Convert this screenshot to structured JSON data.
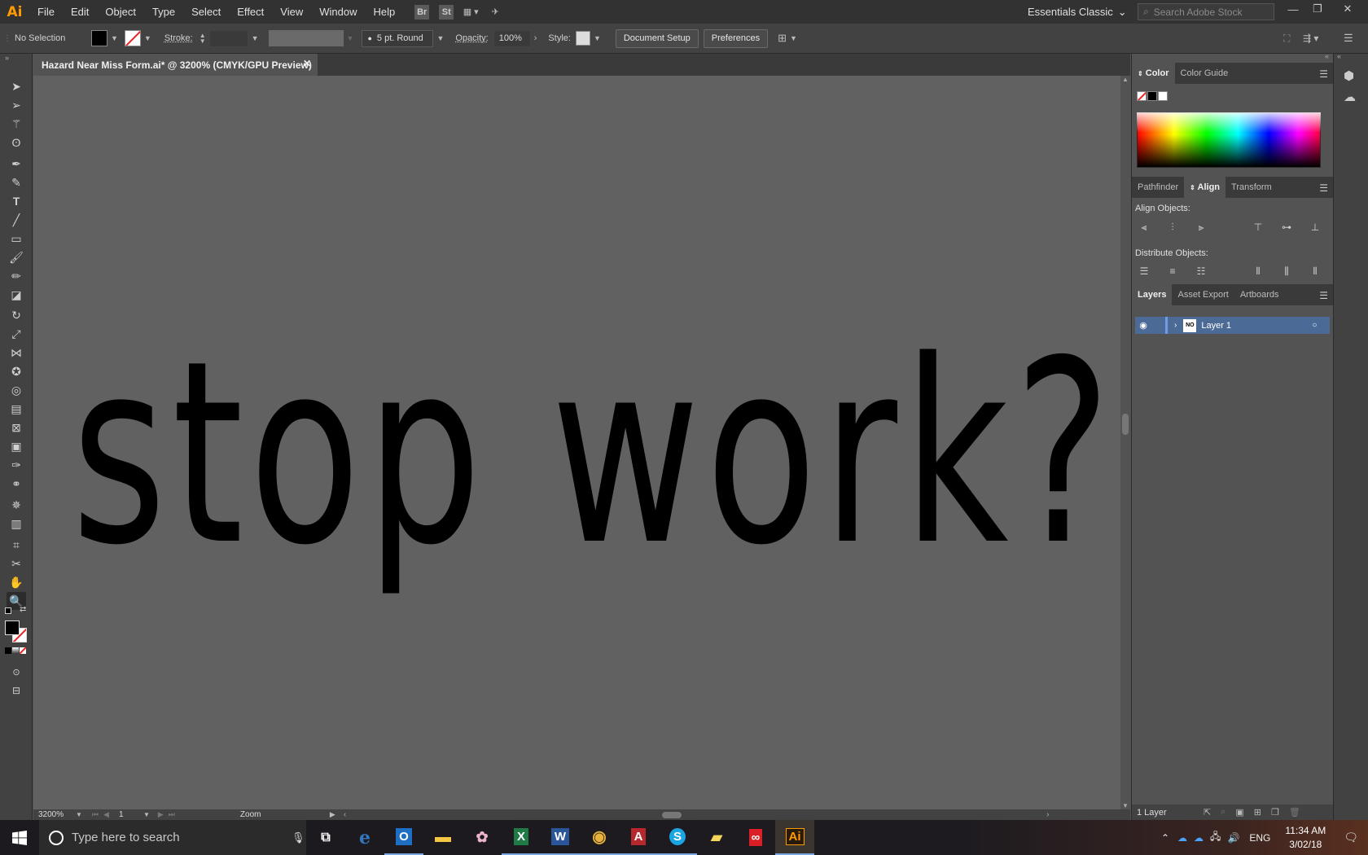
{
  "app": {
    "logo": "Ai",
    "workspace": "Essentials Classic"
  },
  "menu": [
    "File",
    "Edit",
    "Object",
    "Type",
    "Select",
    "Effect",
    "View",
    "Window",
    "Help"
  ],
  "menubar_icons": {
    "bridge": "Br",
    "stock": "St"
  },
  "stock_search": {
    "placeholder": "Search Adobe Stock"
  },
  "control_bar": {
    "selection": "No Selection",
    "stroke_label": "Stroke:",
    "brush": "5 pt. Round",
    "opacity_label": "Opacity:",
    "opacity_value": "100%",
    "style_label": "Style:",
    "document_setup": "Document Setup",
    "preferences": "Preferences"
  },
  "document": {
    "tab_title": "Hazard Near Miss Form.ai* @ 3200% (CMYK/GPU Preview)",
    "canvas_text": "n stop work?",
    "zoom": "3200%",
    "artboard": "1",
    "status_tool": "Zoom"
  },
  "color_panel": {
    "tabs": [
      "Color",
      "Color Guide"
    ]
  },
  "align_panel": {
    "tabs": [
      "Pathfinder",
      "Align",
      "Transform"
    ],
    "align_objects": "Align Objects:",
    "distribute_objects": "Distribute Objects:"
  },
  "layers_panel": {
    "tabs": [
      "Layers",
      "Asset Export",
      "Artboards"
    ],
    "layers": [
      {
        "name": "Layer 1",
        "thumb": "NO"
      }
    ],
    "footer": "1 Layer"
  },
  "taskbar": {
    "search_placeholder": "Type here to search",
    "language": "ENG",
    "time": "11:34 AM",
    "date": "3/02/18",
    "apps": [
      {
        "icon": "edge-icon",
        "glyph": "e",
        "color": "#3277bc"
      },
      {
        "icon": "outlook-icon",
        "glyph": "O",
        "color": "#1e6fc4"
      },
      {
        "icon": "file-explorer-icon",
        "glyph": "▬",
        "color": "#f2c744"
      },
      {
        "icon": "paint-icon",
        "glyph": "✿",
        "color": "#e9b4c8"
      },
      {
        "icon": "excel-icon",
        "glyph": "X",
        "color": "#1f7a45"
      },
      {
        "icon": "word-icon",
        "glyph": "W",
        "color": "#2a5699"
      },
      {
        "icon": "chrome-icon",
        "glyph": "◉",
        "color": "#e8b23a"
      },
      {
        "icon": "access-icon",
        "glyph": "A",
        "color": "#b7282e"
      },
      {
        "icon": "skype-icon",
        "glyph": "S",
        "color": "#1ba5e3"
      },
      {
        "icon": "sticky-notes-icon",
        "glyph": "▰",
        "color": "#f5d55a"
      },
      {
        "icon": "creative-cloud-icon",
        "glyph": "∞",
        "color": "#da1f26"
      },
      {
        "icon": "illustrator-icon",
        "glyph": "Ai",
        "color": "#ff9a00"
      }
    ]
  },
  "colors": {
    "accent_layer": "#4b6a96",
    "ai_orange": "#ff9a00"
  }
}
